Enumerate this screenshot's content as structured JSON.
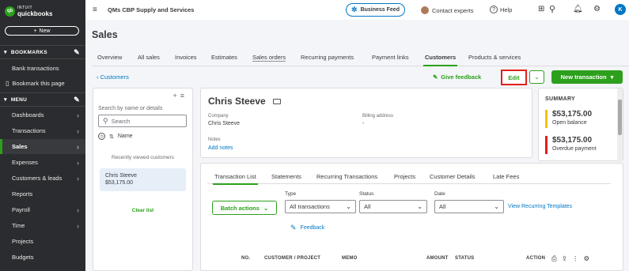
{
  "brand": {
    "top": "INTUIT",
    "bottom": "quickbooks",
    "mark": "qb"
  },
  "sidebar": {
    "new_label": "New",
    "bookmarks_label": "BOOKMARKS",
    "bank_transactions": "Bank transactions",
    "bookmark_page": "Bookmark this page",
    "menu_label": "MENU",
    "items": [
      {
        "label": "Dashboards",
        "arrow": true
      },
      {
        "label": "Transactions",
        "arrow": true
      },
      {
        "label": "Sales",
        "arrow": true,
        "active": true
      },
      {
        "label": "Expenses",
        "arrow": true
      },
      {
        "label": "Customers & leads",
        "arrow": true
      },
      {
        "label": "Reports",
        "arrow": false
      },
      {
        "label": "Payroll",
        "arrow": true
      },
      {
        "label": "Time",
        "arrow": true
      },
      {
        "label": "Projects",
        "arrow": false
      },
      {
        "label": "Budgets",
        "arrow": false
      }
    ]
  },
  "topbar": {
    "company": "QMs CBP Supply and Services",
    "business_feed": "Business Feed",
    "contact": "Contact experts",
    "help": "Help",
    "avatar_letter": "K"
  },
  "page": {
    "title": "Sales",
    "tabs": [
      "Overview",
      "All sales",
      "Invoices",
      "Estimates",
      "Sales orders",
      "Recurring payments",
      "Payment links",
      "Customers",
      "Products & services"
    ],
    "active_tab": "Customers"
  },
  "actions": {
    "back": "Customers",
    "give_feedback": "Give feedback",
    "edit": "Edit",
    "new_transaction": "New transaction"
  },
  "list_panel": {
    "search_label": "Search by name or details",
    "search_placeholder": "Search",
    "sort_label": "Name",
    "recent_label": "Recently viewed customers",
    "recent": [
      {
        "name": "Chris Steeve",
        "amount": "$53,175.00"
      }
    ],
    "clear": "Clear list"
  },
  "customer": {
    "name": "Chris Steeve",
    "company_label": "Company",
    "company_value": "Chris Steeve",
    "billing_label": "Billing address",
    "billing_value": "-",
    "notes_label": "Notes",
    "add_notes": "Add notes"
  },
  "summary": {
    "title": "SUMMARY",
    "open_amount": "$53,175.00",
    "open_label": "Open balance",
    "overdue_amount": "$53,175.00",
    "overdue_label": "Overdue payment",
    "open_color": "#f4c20d",
    "overdue_color": "#e0201b"
  },
  "content": {
    "tabs": [
      "Transaction List",
      "Statements",
      "Recurring Transactions",
      "Projects",
      "Customer Details",
      "Late Fees"
    ],
    "active_tab": "Transaction List",
    "batch_actions": "Batch actions",
    "type_label": "Type",
    "type_value": "All transactions",
    "status_label": "Status",
    "status_value": "All",
    "date_label": "Date",
    "date_value": "All",
    "view_recurring": "View Recurring Templates",
    "feedback": "Feedback",
    "columns": [
      "NO.",
      "CUSTOMER / PROJECT",
      "MEMO",
      "AMOUNT",
      "STATUS",
      "ACTION"
    ]
  },
  "colors": {
    "accent_green": "#2ca01c",
    "link_blue": "#0077c5",
    "sidebar_bg": "#2b2c2f"
  }
}
